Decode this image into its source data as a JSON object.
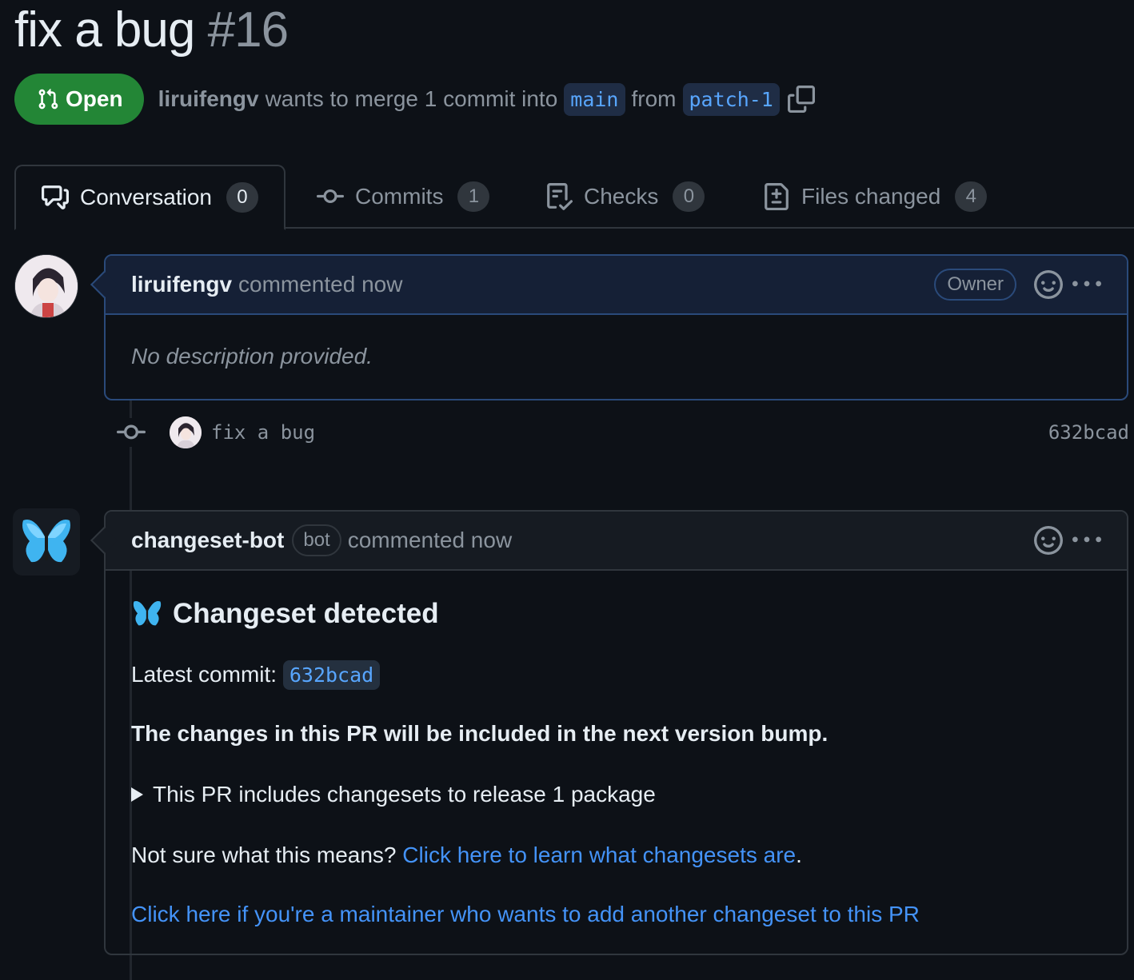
{
  "pr": {
    "title": "fix a bug",
    "number": "#16",
    "state": "Open",
    "author": "liruifengv",
    "merge_text_1": "wants to merge 1 commit into",
    "base_branch": "main",
    "from_text": "from",
    "head_branch": "patch-1"
  },
  "tabs": [
    {
      "label": "Conversation",
      "count": "0",
      "icon": "comment-discussion-icon"
    },
    {
      "label": "Commits",
      "count": "1",
      "icon": "git-commit-icon"
    },
    {
      "label": "Checks",
      "count": "0",
      "icon": "checklist-icon"
    },
    {
      "label": "Files changed",
      "count": "4",
      "icon": "file-diff-icon"
    }
  ],
  "comment1": {
    "author": "liruifengv",
    "meta": "commented now",
    "role": "Owner",
    "body": "No description provided."
  },
  "commit": {
    "message": "fix a bug",
    "sha": "632bcad"
  },
  "comment2": {
    "author": "changeset-bot",
    "badge": "bot",
    "meta": "commented now",
    "heading": "Changeset detected",
    "latest_label": "Latest commit:",
    "latest_sha": "632bcad",
    "bold_line": "The changes in this PR will be included in the next version bump.",
    "details_summary": "This PR includes changesets to release 1 package",
    "not_sure": "Not sure what this means?",
    "learn_link": "Click here to learn what changesets are",
    "period": ".",
    "maintainer_link": "Click here if you're a maintainer who wants to add another changeset to this PR"
  },
  "colors": {
    "open_green": "#238636",
    "link_blue": "#4493f8",
    "background": "#0d1117"
  }
}
